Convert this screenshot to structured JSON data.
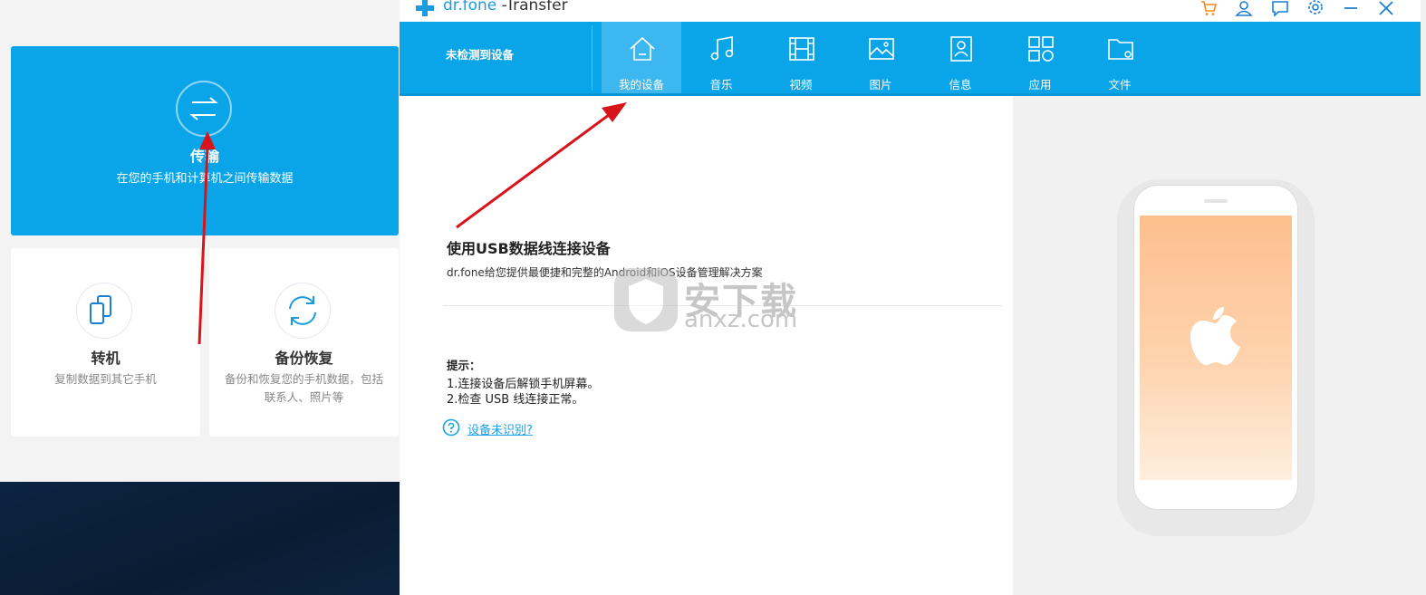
{
  "background_app": {
    "transfer": {
      "title": "传输",
      "desc": "在您的手机和计算机之间传输数据"
    },
    "switch": {
      "title": "转机",
      "desc": "复制数据到其它手机"
    },
    "backup": {
      "title": "备份恢复",
      "desc_line1": "备份和恢复您的手机数据，包括",
      "desc_line2": "联系人、照片等"
    }
  },
  "window": {
    "logo_text": "dr.fone",
    "title_suffix": " -Transfer"
  },
  "header": {
    "device_status": "未检测到设备",
    "tabs": [
      {
        "label": "我的设备",
        "icon": "home-icon",
        "active": true
      },
      {
        "label": "音乐",
        "icon": "music-icon"
      },
      {
        "label": "视频",
        "icon": "film-icon"
      },
      {
        "label": "图片",
        "icon": "image-icon"
      },
      {
        "label": "信息",
        "icon": "contact-card-icon"
      },
      {
        "label": "应用",
        "icon": "apps-icon"
      },
      {
        "label": "文件",
        "icon": "folder-icon"
      }
    ]
  },
  "content": {
    "connect_title": "使用USB数据线连接设备",
    "connect_desc": "dr.fone给您提供最便捷和完整的Android和iOS设备管理解决方案",
    "tips_title": "提示：",
    "tip_1": "1.连接设备后解锁手机屏幕。",
    "tip_2": "2.检查 USB 线连接正常。",
    "help_link": "设备未识别?"
  },
  "watermark": {
    "text": "安下载",
    "sub": "anxz.com"
  },
  "colors": {
    "accent": "#0aa5e8",
    "active_tab": "#3cb7ef",
    "link": "#1aa3e6",
    "arrow": "#d8141b"
  }
}
